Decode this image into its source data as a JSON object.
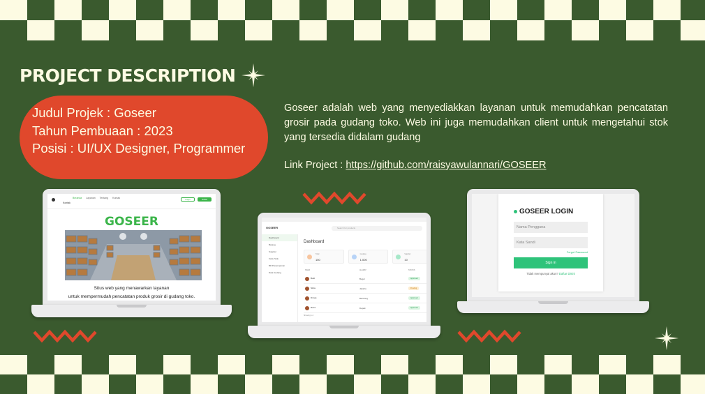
{
  "slide": {
    "heading": "PROJECT DESCRIPTION",
    "colors": {
      "background": "#3a5a2e",
      "cream": "#fdfbe3",
      "accent": "#e0482c",
      "brand_green": "#3bb54a"
    }
  },
  "details": {
    "title_line": "Judul Projek : Goseer",
    "year_line": "Tahun Pembuaan : 2023",
    "role_line": "Posisi : UI/UX Designer, Programmer"
  },
  "description": "Goseer adalah web yang menyediakkan layanan untuk memudahkan pencatatan grosir pada gudang toko. Web ini juga memudahkan client untuk mengetahui stok yang tersedia didalam gudang",
  "link": {
    "label": "Link Project : ",
    "url_text": "https://github.com/raisyawulannari/GOSEER"
  },
  "mockup_landing": {
    "menu": [
      "Beranda",
      "Layanan",
      "Tentang",
      "Kontak"
    ],
    "sub_label": "Kontak",
    "login_label": "Login",
    "register_label": "Daftar",
    "brand": "GOSEER",
    "caption_line1": "Situs web yang menawarkan layanan",
    "caption_line2": "untuk mempermudah pencatatan produk grosir di gudang toko."
  },
  "mockup_dashboard": {
    "brand": "GOSEER",
    "search_placeholder": "Search for products",
    "sidebar": [
      "Dashboard",
      "Barang",
      "Supplier",
      "Kartu Stok",
      "Bill Penyimpanan",
      "Data Gudang"
    ],
    "heading": "Dashboard",
    "cards": [
      {
        "label": "Total",
        "value": "150",
        "color": "#f7c59f"
      },
      {
        "label": "Gudang",
        "value": "1.000",
        "color": "#b7d3f7"
      },
      {
        "label": "Supplier",
        "value": "10",
        "color": "#a7e8c9"
      }
    ],
    "columns": [
      "NAMA",
      "ALAMAT",
      "STATUS"
    ],
    "rows": [
      {
        "name": "Budi",
        "address": "Bogor",
        "status": "Approved",
        "bg": "#dcf5e3",
        "fg": "#2a9d55"
      },
      {
        "name": "Sinta",
        "address": "Jakarta",
        "status": "Pending",
        "bg": "#fdeccf",
        "fg": "#c77c0e"
      },
      {
        "name": "Dimas",
        "address": "Bandung",
        "status": "Approved",
        "bg": "#dcf5e3",
        "fg": "#2a9d55"
      },
      {
        "name": "Reza",
        "address": "Depok",
        "status": "Approved",
        "bg": "#dcf5e3",
        "fg": "#2a9d55"
      }
    ],
    "footer": "Showing 1-4"
  },
  "mockup_login": {
    "title": "GOSEER LOGIN",
    "username_placeholder": "Nama Pengguna",
    "password_placeholder": "Kata Sandi",
    "forgot": "Forgot Password",
    "submit": "Sign in",
    "register_prompt": "Tidak mempunyai akun?",
    "register_link": "Daftar Disini"
  }
}
